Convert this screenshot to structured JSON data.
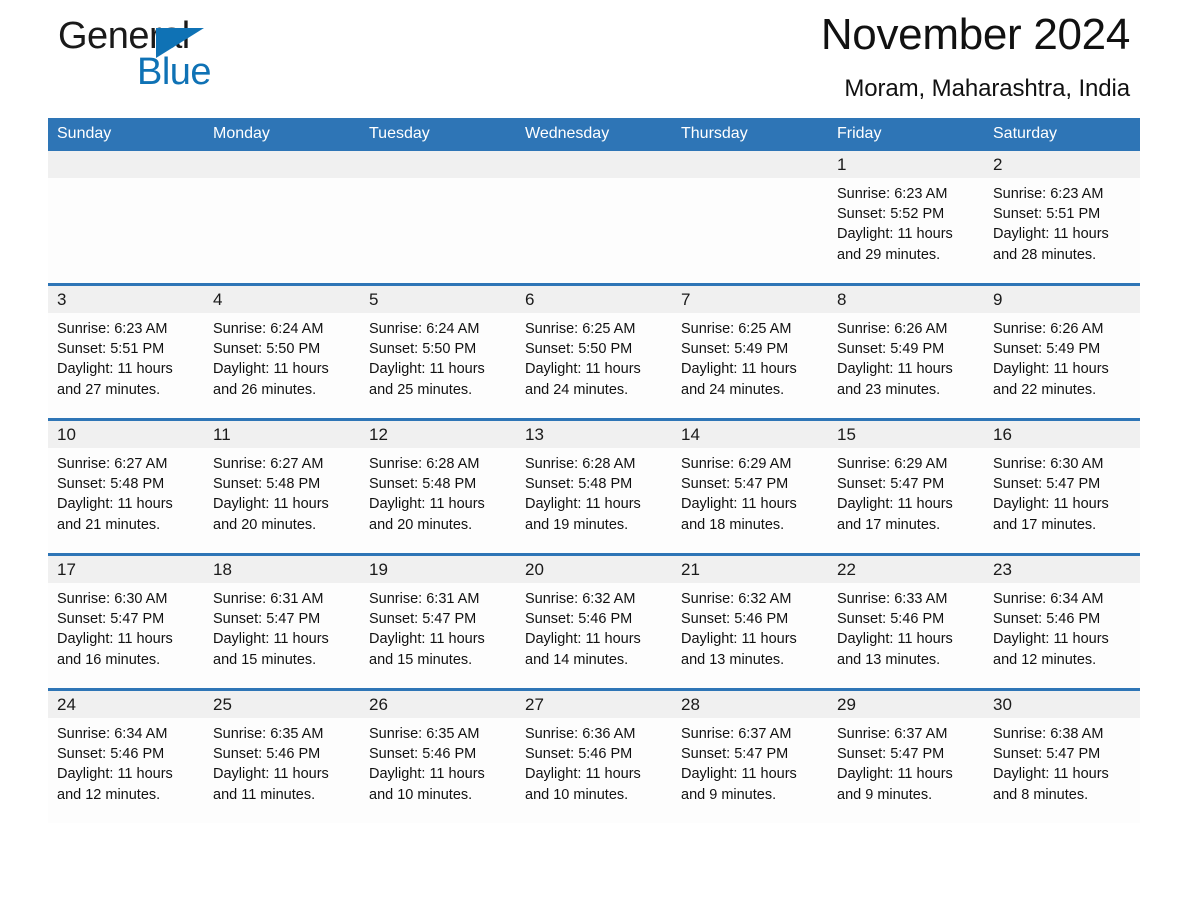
{
  "brand": {
    "name_dark": "General",
    "name_light": "Blue",
    "triangle_color": "#0f72b5"
  },
  "header": {
    "month_title": "November 2024",
    "location": "Moram, Maharashtra, India",
    "header_bg": "#2e75b6",
    "daynum_band_bg": "#f0f0f0"
  },
  "weekdays": [
    "Sunday",
    "Monday",
    "Tuesday",
    "Wednesday",
    "Thursday",
    "Friday",
    "Saturday"
  ],
  "weeks": [
    [
      {
        "day": "",
        "sunrise": "",
        "sunset": "",
        "daylight_l1": "",
        "daylight_l2": ""
      },
      {
        "day": "",
        "sunrise": "",
        "sunset": "",
        "daylight_l1": "",
        "daylight_l2": ""
      },
      {
        "day": "",
        "sunrise": "",
        "sunset": "",
        "daylight_l1": "",
        "daylight_l2": ""
      },
      {
        "day": "",
        "sunrise": "",
        "sunset": "",
        "daylight_l1": "",
        "daylight_l2": ""
      },
      {
        "day": "",
        "sunrise": "",
        "sunset": "",
        "daylight_l1": "",
        "daylight_l2": ""
      },
      {
        "day": "1",
        "sunrise": "Sunrise: 6:23 AM",
        "sunset": "Sunset: 5:52 PM",
        "daylight_l1": "Daylight: 11 hours",
        "daylight_l2": "and 29 minutes."
      },
      {
        "day": "2",
        "sunrise": "Sunrise: 6:23 AM",
        "sunset": "Sunset: 5:51 PM",
        "daylight_l1": "Daylight: 11 hours",
        "daylight_l2": "and 28 minutes."
      }
    ],
    [
      {
        "day": "3",
        "sunrise": "Sunrise: 6:23 AM",
        "sunset": "Sunset: 5:51 PM",
        "daylight_l1": "Daylight: 11 hours",
        "daylight_l2": "and 27 minutes."
      },
      {
        "day": "4",
        "sunrise": "Sunrise: 6:24 AM",
        "sunset": "Sunset: 5:50 PM",
        "daylight_l1": "Daylight: 11 hours",
        "daylight_l2": "and 26 minutes."
      },
      {
        "day": "5",
        "sunrise": "Sunrise: 6:24 AM",
        "sunset": "Sunset: 5:50 PM",
        "daylight_l1": "Daylight: 11 hours",
        "daylight_l2": "and 25 minutes."
      },
      {
        "day": "6",
        "sunrise": "Sunrise: 6:25 AM",
        "sunset": "Sunset: 5:50 PM",
        "daylight_l1": "Daylight: 11 hours",
        "daylight_l2": "and 24 minutes."
      },
      {
        "day": "7",
        "sunrise": "Sunrise: 6:25 AM",
        "sunset": "Sunset: 5:49 PM",
        "daylight_l1": "Daylight: 11 hours",
        "daylight_l2": "and 24 minutes."
      },
      {
        "day": "8",
        "sunrise": "Sunrise: 6:26 AM",
        "sunset": "Sunset: 5:49 PM",
        "daylight_l1": "Daylight: 11 hours",
        "daylight_l2": "and 23 minutes."
      },
      {
        "day": "9",
        "sunrise": "Sunrise: 6:26 AM",
        "sunset": "Sunset: 5:49 PM",
        "daylight_l1": "Daylight: 11 hours",
        "daylight_l2": "and 22 minutes."
      }
    ],
    [
      {
        "day": "10",
        "sunrise": "Sunrise: 6:27 AM",
        "sunset": "Sunset: 5:48 PM",
        "daylight_l1": "Daylight: 11 hours",
        "daylight_l2": "and 21 minutes."
      },
      {
        "day": "11",
        "sunrise": "Sunrise: 6:27 AM",
        "sunset": "Sunset: 5:48 PM",
        "daylight_l1": "Daylight: 11 hours",
        "daylight_l2": "and 20 minutes."
      },
      {
        "day": "12",
        "sunrise": "Sunrise: 6:28 AM",
        "sunset": "Sunset: 5:48 PM",
        "daylight_l1": "Daylight: 11 hours",
        "daylight_l2": "and 20 minutes."
      },
      {
        "day": "13",
        "sunrise": "Sunrise: 6:28 AM",
        "sunset": "Sunset: 5:48 PM",
        "daylight_l1": "Daylight: 11 hours",
        "daylight_l2": "and 19 minutes."
      },
      {
        "day": "14",
        "sunrise": "Sunrise: 6:29 AM",
        "sunset": "Sunset: 5:47 PM",
        "daylight_l1": "Daylight: 11 hours",
        "daylight_l2": "and 18 minutes."
      },
      {
        "day": "15",
        "sunrise": "Sunrise: 6:29 AM",
        "sunset": "Sunset: 5:47 PM",
        "daylight_l1": "Daylight: 11 hours",
        "daylight_l2": "and 17 minutes."
      },
      {
        "day": "16",
        "sunrise": "Sunrise: 6:30 AM",
        "sunset": "Sunset: 5:47 PM",
        "daylight_l1": "Daylight: 11 hours",
        "daylight_l2": "and 17 minutes."
      }
    ],
    [
      {
        "day": "17",
        "sunrise": "Sunrise: 6:30 AM",
        "sunset": "Sunset: 5:47 PM",
        "daylight_l1": "Daylight: 11 hours",
        "daylight_l2": "and 16 minutes."
      },
      {
        "day": "18",
        "sunrise": "Sunrise: 6:31 AM",
        "sunset": "Sunset: 5:47 PM",
        "daylight_l1": "Daylight: 11 hours",
        "daylight_l2": "and 15 minutes."
      },
      {
        "day": "19",
        "sunrise": "Sunrise: 6:31 AM",
        "sunset": "Sunset: 5:47 PM",
        "daylight_l1": "Daylight: 11 hours",
        "daylight_l2": "and 15 minutes."
      },
      {
        "day": "20",
        "sunrise": "Sunrise: 6:32 AM",
        "sunset": "Sunset: 5:46 PM",
        "daylight_l1": "Daylight: 11 hours",
        "daylight_l2": "and 14 minutes."
      },
      {
        "day": "21",
        "sunrise": "Sunrise: 6:32 AM",
        "sunset": "Sunset: 5:46 PM",
        "daylight_l1": "Daylight: 11 hours",
        "daylight_l2": "and 13 minutes."
      },
      {
        "day": "22",
        "sunrise": "Sunrise: 6:33 AM",
        "sunset": "Sunset: 5:46 PM",
        "daylight_l1": "Daylight: 11 hours",
        "daylight_l2": "and 13 minutes."
      },
      {
        "day": "23",
        "sunrise": "Sunrise: 6:34 AM",
        "sunset": "Sunset: 5:46 PM",
        "daylight_l1": "Daylight: 11 hours",
        "daylight_l2": "and 12 minutes."
      }
    ],
    [
      {
        "day": "24",
        "sunrise": "Sunrise: 6:34 AM",
        "sunset": "Sunset: 5:46 PM",
        "daylight_l1": "Daylight: 11 hours",
        "daylight_l2": "and 12 minutes."
      },
      {
        "day": "25",
        "sunrise": "Sunrise: 6:35 AM",
        "sunset": "Sunset: 5:46 PM",
        "daylight_l1": "Daylight: 11 hours",
        "daylight_l2": "and 11 minutes."
      },
      {
        "day": "26",
        "sunrise": "Sunrise: 6:35 AM",
        "sunset": "Sunset: 5:46 PM",
        "daylight_l1": "Daylight: 11 hours",
        "daylight_l2": "and 10 minutes."
      },
      {
        "day": "27",
        "sunrise": "Sunrise: 6:36 AM",
        "sunset": "Sunset: 5:46 PM",
        "daylight_l1": "Daylight: 11 hours",
        "daylight_l2": "and 10 minutes."
      },
      {
        "day": "28",
        "sunrise": "Sunrise: 6:37 AM",
        "sunset": "Sunset: 5:47 PM",
        "daylight_l1": "Daylight: 11 hours",
        "daylight_l2": "and 9 minutes."
      },
      {
        "day": "29",
        "sunrise": "Sunrise: 6:37 AM",
        "sunset": "Sunset: 5:47 PM",
        "daylight_l1": "Daylight: 11 hours",
        "daylight_l2": "and 9 minutes."
      },
      {
        "day": "30",
        "sunrise": "Sunrise: 6:38 AM",
        "sunset": "Sunset: 5:47 PM",
        "daylight_l1": "Daylight: 11 hours",
        "daylight_l2": "and 8 minutes."
      }
    ]
  ]
}
